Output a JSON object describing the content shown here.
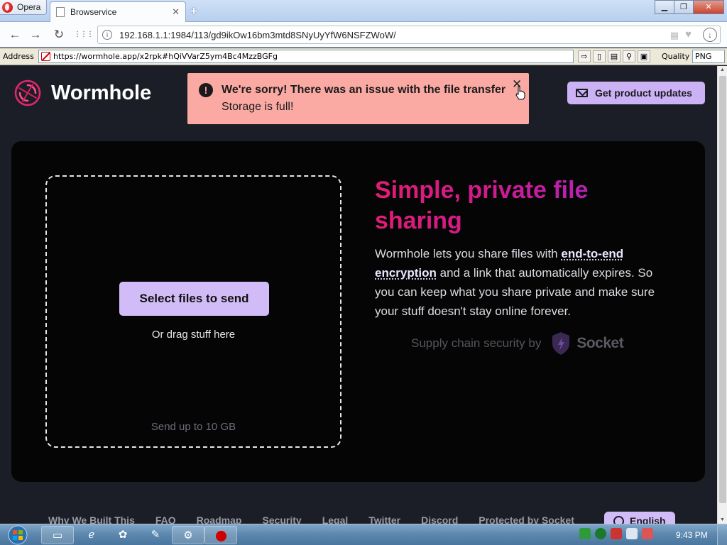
{
  "browser": {
    "menu_label": "Opera",
    "tab_title": "Browservice",
    "tab_close": "✕",
    "new_tab": "+",
    "window_buttons": {
      "minimize": "▁",
      "maximize": "❐",
      "close": "✕"
    },
    "url": "192.168.1.1:1984/113/gd9ikOw16bm3mtd8SNyUyYfW6NSFZWoW/",
    "nav": {
      "back": "←",
      "forward": "→",
      "reload": "↻",
      "speed_dial": "⋮⋮⋮"
    }
  },
  "address_bar": {
    "label": "Address",
    "url": "https://wormhole.app/x2rpk#hQiVVarZ5ym4Bc4MzzBGFg",
    "quality_label": "Quality",
    "quality_value": "PNG"
  },
  "page": {
    "brand_name": "Wormhole",
    "updates_button": "Get product updates",
    "toast": {
      "icon": "!",
      "title": "We're sorry! There was an issue with the file transfer",
      "message": "Storage is full!",
      "close": "✕"
    },
    "dropzone": {
      "select_button": "Select files to send",
      "drag_text": "Or drag stuff here",
      "limit_text": "Send up to 10 GB"
    },
    "hero": {
      "headline": "Simple, private file sharing",
      "desc_before": "Wormhole lets you share files with ",
      "desc_link": "end-to-end encryption",
      "desc_after": " and a link that automatically expires. So you can keep what you share private and make sure your stuff doesn't stay online forever."
    },
    "supply_chain": {
      "text": "Supply chain security by",
      "brand": "Socket"
    },
    "footer_links": [
      "Why We Built This",
      "FAQ",
      "Roadmap",
      "Security",
      "Legal",
      "Twitter",
      "Discord",
      "Protected by Socket"
    ],
    "language_button": "English"
  },
  "taskbar": {
    "clock": "9:43 PM"
  },
  "colors": {
    "toast_bg": "#faa9a3",
    "accent_purple": "#cbb2f4",
    "headline_gradient": [
      "#e11d74",
      "#a826c4"
    ],
    "page_bg": "#1b1e27",
    "card_bg": "#050506"
  }
}
